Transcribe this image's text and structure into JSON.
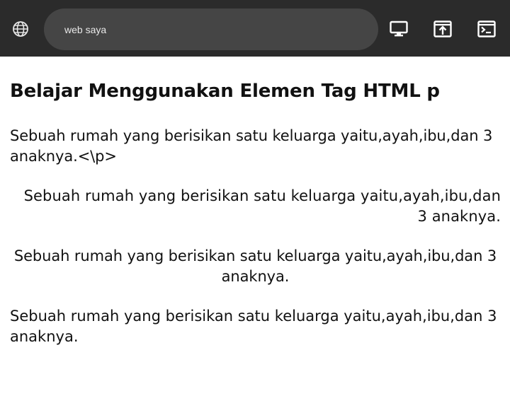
{
  "toolbar": {
    "url": "web saya",
    "icons": [
      "globe-icon",
      "monitor-icon",
      "open-external-icon",
      "terminal-icon"
    ],
    "background": "#2b2b2b",
    "urlbar_background": "#454545"
  },
  "page": {
    "heading": "Belajar Menggunakan Elemen Tag HTML p",
    "paragraphs": [
      "Sebuah rumah yang berisikan satu keluarga yaitu,ayah,ibu,dan 3 anaknya.<\\p>",
      "Sebuah rumah yang berisikan satu keluarga yaitu,ayah,ibu,dan 3 anaknya.",
      "Sebuah rumah yang berisikan satu keluarga yaitu,ayah,ibu,dan 3 anaknya.",
      "Sebuah rumah yang berisikan satu keluarga yaitu,ayah,ibu,dan 3 anaknya."
    ],
    "alignments": [
      "left",
      "right",
      "center",
      "justify"
    ]
  }
}
